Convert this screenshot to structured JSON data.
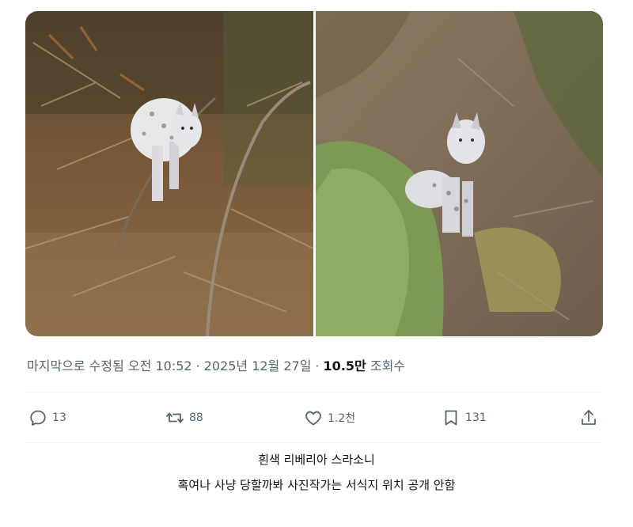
{
  "photos": {
    "left_alt": "",
    "right_alt": ""
  },
  "meta": {
    "edited_time": "마지막으로 수정됨 오전 10:52",
    "separator": "·",
    "date": "2025년 12월 27일",
    "views_count": "10.5만",
    "views_label": "조회수"
  },
  "actions": {
    "replies": "13",
    "retweets": "88",
    "likes": "1.2천",
    "bookmarks": "131"
  },
  "caption": {
    "line1": "흰색 리베리아 스라소니",
    "line2": "혹여나 사냥 당할까봐 사진작가는 서식지 위치 공개 안함"
  },
  "colors": {
    "meta_text": "#536471",
    "emphasis_text": "#0f1419",
    "divider": "#eff3f4"
  }
}
